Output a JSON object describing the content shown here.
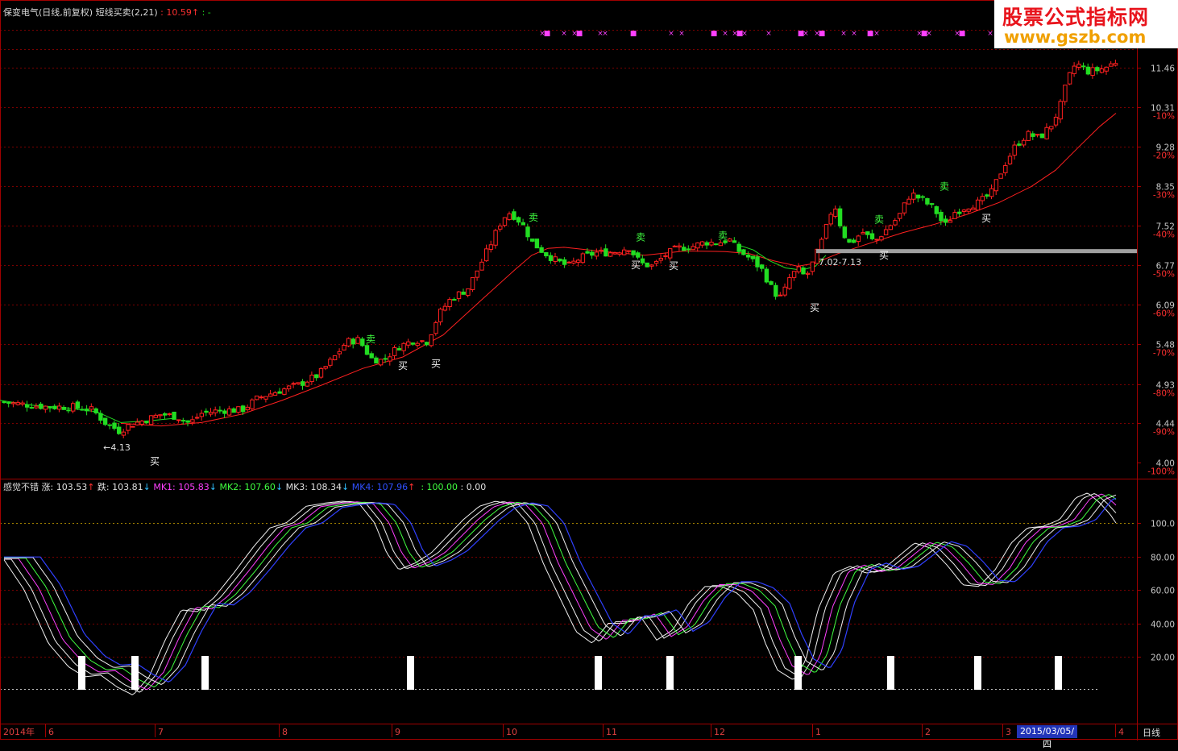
{
  "header": {
    "stock_title": "保变电气(日线,前复权) 短线买卖(2,21)",
    "price_label": ": 10.59",
    "price_arrow": "↑",
    "dash_label": ": -"
  },
  "indicator_header": {
    "name": "感觉不错",
    "zhang_label": "涨: 103.53",
    "zhang_arrow": "↑",
    "die_label": "跌: 103.81",
    "die_arrow": "↓",
    "mk1_label": "MK1: 105.83",
    "mk1_arrow": "↓",
    "mk2_label": "MK2: 107.60",
    "mk2_arrow": "↓",
    "mk3_label": "MK3: 108.34",
    "mk3_arrow": "↓",
    "mk4_label": "MK4: 107.96",
    "mk4_arrow": "↑",
    "level_label": ": 100.00",
    "zero_label": ": 0.00"
  },
  "watermark": {
    "line1": "股票公式指标网",
    "line2": "www.gszb.com"
  },
  "date_badge": "2015/03/05/四",
  "period_label": "日线",
  "colors": {
    "up": "#ff2020",
    "down": "#22dd22",
    "ma": "#ff2020",
    "grid": "#7a0000",
    "axis": "#a00000",
    "mk1": "#ff40ff",
    "mk2": "#40ff40",
    "mk3": "#e0e0e0",
    "mk4": "#3040ff"
  },
  "chart_data": [
    {
      "type": "candlestick",
      "title": "保变电气(日线,前复权) 短线买卖(2,21)",
      "y_ticks": [
        11.46,
        10.31,
        9.28,
        8.35,
        7.52,
        6.77,
        6.09,
        5.48,
        4.93,
        4.44,
        4.0
      ],
      "y_tick_labels": [
        "11.46",
        "10.31",
        "9.28",
        "8.35",
        "7.52",
        "6.77",
        "6.09",
        "5.48",
        "4.93",
        "4.44",
        "4.00"
      ],
      "pct_labels": [
        "-10%",
        "-20%",
        "-30%",
        "-40%",
        "-50%",
        "-60%",
        "-70%",
        "-80%",
        "-90%",
        "-100%"
      ],
      "ylim": [
        4.0,
        12.0
      ],
      "x_labels": [
        "2014年",
        "6",
        "7",
        "8",
        "9",
        "10",
        "11",
        "12",
        "1",
        "2",
        "3",
        "4"
      ],
      "close_path": [
        [
          0,
          4.7
        ],
        [
          30,
          4.67
        ],
        [
          60,
          4.64
        ],
        [
          90,
          4.64
        ],
        [
          115,
          4.6
        ],
        [
          130,
          4.45
        ],
        [
          148,
          4.35
        ],
        [
          160,
          4.42
        ],
        [
          180,
          4.48
        ],
        [
          200,
          4.55
        ],
        [
          220,
          4.52
        ],
        [
          235,
          4.44
        ],
        [
          250,
          4.56
        ],
        [
          275,
          4.6
        ],
        [
          300,
          4.6
        ],
        [
          320,
          4.75
        ],
        [
          345,
          4.84
        ],
        [
          370,
          4.92
        ],
        [
          395,
          5.05
        ],
        [
          415,
          5.3
        ],
        [
          430,
          5.52
        ],
        [
          445,
          5.55
        ],
        [
          460,
          5.28
        ],
        [
          475,
          5.25
        ],
        [
          495,
          5.45
        ],
        [
          515,
          5.55
        ],
        [
          530,
          5.52
        ],
        [
          545,
          5.95
        ],
        [
          560,
          6.2
        ],
        [
          580,
          6.35
        ],
        [
          595,
          6.75
        ],
        [
          610,
          7.2
        ],
        [
          620,
          7.55
        ],
        [
          630,
          7.8
        ],
        [
          640,
          7.7
        ],
        [
          650,
          7.5
        ],
        [
          660,
          7.2
        ],
        [
          675,
          7.0
        ],
        [
          690,
          6.85
        ],
        [
          705,
          6.75
        ],
        [
          720,
          6.9
        ],
        [
          740,
          7.0
        ],
        [
          760,
          7.0
        ],
        [
          780,
          7.1
        ],
        [
          795,
          6.8
        ],
        [
          810,
          6.75
        ],
        [
          825,
          6.95
        ],
        [
          840,
          7.08
        ],
        [
          860,
          7.12
        ],
        [
          875,
          7.2
        ],
        [
          890,
          7.18
        ],
        [
          905,
          7.25
        ],
        [
          915,
          7.05
        ],
        [
          930,
          6.9
        ],
        [
          945,
          6.7
        ],
        [
          960,
          6.3
        ],
        [
          970,
          6.2
        ],
        [
          980,
          6.55
        ],
        [
          990,
          6.7
        ],
        [
          1000,
          6.55
        ],
        [
          1010,
          6.85
        ],
        [
          1022,
          7.3
        ],
        [
          1035,
          8.0
        ],
        [
          1045,
          7.4
        ],
        [
          1055,
          7.15
        ],
        [
          1070,
          7.4
        ],
        [
          1085,
          7.2
        ],
        [
          1100,
          7.45
        ],
        [
          1115,
          7.7
        ],
        [
          1130,
          8.2
        ],
        [
          1145,
          8.05
        ],
        [
          1160,
          7.85
        ],
        [
          1172,
          7.5
        ],
        [
          1185,
          7.8
        ],
        [
          1200,
          7.92
        ],
        [
          1215,
          8.0
        ],
        [
          1230,
          8.2
        ],
        [
          1245,
          8.8
        ],
        [
          1260,
          9.3
        ],
        [
          1275,
          9.6
        ],
        [
          1290,
          9.5
        ],
        [
          1305,
          9.85
        ],
        [
          1315,
          10.3
        ],
        [
          1325,
          11.1
        ],
        [
          1335,
          11.6
        ],
        [
          1350,
          11.35
        ],
        [
          1365,
          11.4
        ],
        [
          1375,
          11.5
        ],
        [
          1388,
          11.7
        ]
      ],
      "ma_path": [
        [
          150,
          4.44
        ],
        [
          200,
          4.41
        ],
        [
          250,
          4.45
        ],
        [
          300,
          4.55
        ],
        [
          350,
          4.72
        ],
        [
          400,
          4.92
        ],
        [
          450,
          5.14
        ],
        [
          500,
          5.3
        ],
        [
          550,
          5.62
        ],
        [
          600,
          6.2
        ],
        [
          640,
          6.7
        ],
        [
          660,
          6.95
        ],
        [
          680,
          7.08
        ],
        [
          700,
          7.1
        ],
        [
          750,
          7.02
        ],
        [
          800,
          6.95
        ],
        [
          850,
          7.03
        ],
        [
          900,
          7.02
        ],
        [
          930,
          6.98
        ],
        [
          960,
          6.85
        ],
        [
          990,
          6.75
        ],
        [
          1010,
          6.8
        ],
        [
          1040,
          6.98
        ],
        [
          1080,
          7.18
        ],
        [
          1120,
          7.38
        ],
        [
          1160,
          7.55
        ],
        [
          1200,
          7.75
        ],
        [
          1240,
          8.0
        ],
        [
          1280,
          8.35
        ],
        [
          1310,
          8.72
        ],
        [
          1340,
          9.3
        ],
        [
          1365,
          9.8
        ],
        [
          1385,
          10.15
        ]
      ],
      "annotations": [
        {
          "text": "←4.13",
          "x": 145,
          "price": 4.13
        },
        {
          "text": "买",
          "x": 192,
          "price": 3.98
        },
        {
          "text": "卖",
          "x": 460,
          "price": 5.51
        },
        {
          "text": "买",
          "x": 500,
          "price": 5.13
        },
        {
          "text": "买",
          "x": 541,
          "price": 5.16
        },
        {
          "text": "卖",
          "x": 662,
          "price": 7.62
        },
        {
          "text": "买",
          "x": 789,
          "price": 6.71
        },
        {
          "text": "卖",
          "x": 795,
          "price": 7.23
        },
        {
          "text": "买",
          "x": 836,
          "price": 6.7
        },
        {
          "text": "卖",
          "x": 897,
          "price": 7.26
        },
        {
          "text": "买",
          "x": 1011,
          "price": 5.99
        },
        {
          "text": "买",
          "x": 1097,
          "price": 6.89
        },
        {
          "text": "卖",
          "x": 1091,
          "price": 7.58
        },
        {
          "text": "卖",
          "x": 1172,
          "price": 8.28
        },
        {
          "text": "买",
          "x": 1224,
          "price": 7.6
        }
      ],
      "range_label": "7.02-7.13",
      "range_price": 7.02
    },
    {
      "type": "line",
      "title": "感觉不错",
      "ylim": [
        -5,
        120
      ],
      "y_ticks": [
        100,
        80,
        60,
        40,
        20
      ],
      "y_tick_labels": [
        "100.0",
        "80.00",
        "60.00",
        "40.00",
        "20.00"
      ],
      "signal_bars_x": [
        101,
        167,
        254,
        509,
        742,
        831,
        990,
        1105,
        1213,
        1313
      ],
      "series_path": [
        [
          5,
          78
        ],
        [
          30,
          60
        ],
        [
          60,
          28
        ],
        [
          85,
          14
        ],
        [
          105,
          8
        ],
        [
          125,
          9
        ],
        [
          145,
          2
        ],
        [
          165,
          -3
        ],
        [
          185,
          8
        ],
        [
          205,
          30
        ],
        [
          225,
          48
        ],
        [
          245,
          47
        ],
        [
          265,
          55
        ],
        [
          290,
          70
        ],
        [
          315,
          86
        ],
        [
          335,
          97
        ],
        [
          355,
          100
        ],
        [
          380,
          110
        ],
        [
          405,
          112
        ],
        [
          425,
          113
        ],
        [
          445,
          112
        ],
        [
          465,
          100
        ],
        [
          480,
          82
        ],
        [
          495,
          72
        ],
        [
          515,
          76
        ],
        [
          535,
          82
        ],
        [
          555,
          92
        ],
        [
          575,
          102
        ],
        [
          595,
          110
        ],
        [
          615,
          113
        ],
        [
          635,
          111
        ],
        [
          655,
          100
        ],
        [
          675,
          75
        ],
        [
          695,
          55
        ],
        [
          715,
          35
        ],
        [
          735,
          28
        ],
        [
          755,
          40
        ],
        [
          775,
          40
        ],
        [
          795,
          44
        ],
        [
          815,
          30
        ],
        [
          835,
          36
        ],
        [
          855,
          52
        ],
        [
          875,
          62
        ],
        [
          895,
          62
        ],
        [
          915,
          58
        ],
        [
          935,
          48
        ],
        [
          950,
          28
        ],
        [
          965,
          12
        ],
        [
          985,
          6
        ],
        [
          1000,
          18
        ],
        [
          1015,
          48
        ],
        [
          1035,
          70
        ],
        [
          1055,
          74
        ],
        [
          1075,
          70
        ],
        [
          1095,
          72
        ],
        [
          1115,
          80
        ],
        [
          1135,
          88
        ],
        [
          1155,
          85
        ],
        [
          1175,
          75
        ],
        [
          1195,
          63
        ],
        [
          1215,
          62
        ],
        [
          1235,
          72
        ],
        [
          1255,
          88
        ],
        [
          1275,
          97
        ],
        [
          1295,
          98
        ],
        [
          1315,
          102
        ],
        [
          1335,
          115
        ],
        [
          1350,
          118
        ],
        [
          1365,
          112
        ],
        [
          1378,
          105
        ],
        [
          1385,
          100
        ]
      ]
    }
  ]
}
